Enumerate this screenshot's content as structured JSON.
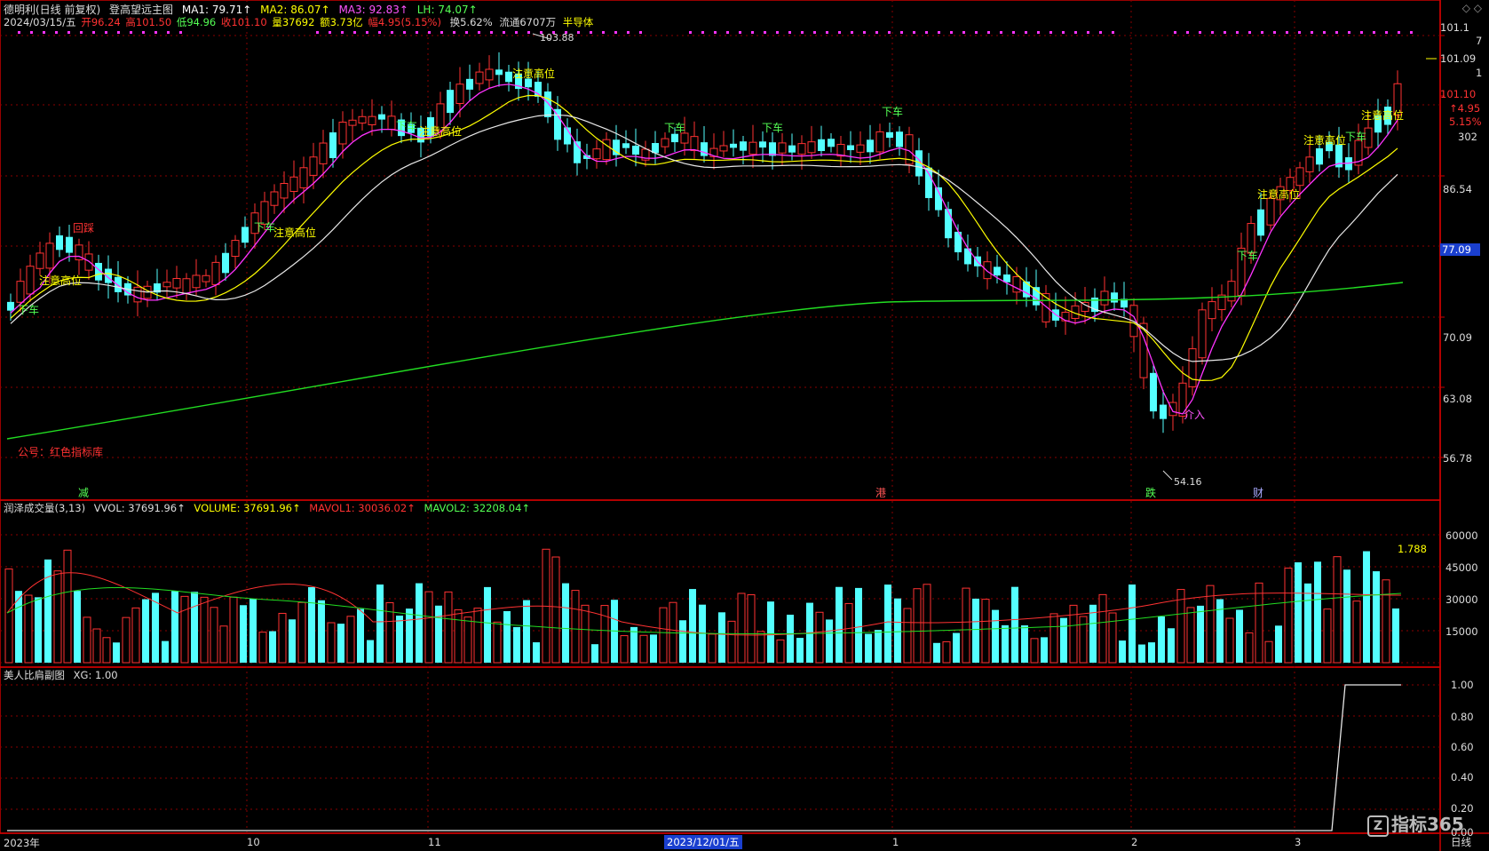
{
  "header": {
    "stock_name": "德明利(日线 前复权)",
    "indicator_name": "登高望远主图",
    "ma1": "MA1: 79.71↑",
    "ma2": "MA2: 86.07↑",
    "ma3": "MA3: 92.83↑",
    "lh": "LH: 74.07↑",
    "date": "2024/03/15/五",
    "open": "开96.24",
    "high": "高101.50",
    "low": "低94.96",
    "close": "收101.10",
    "vol": "量37692",
    "amount": "额3.73亿",
    "change": "幅4.95(5.15%)",
    "turnover": "换5.62%",
    "float_cap": "流通6707万",
    "sector": "半导体",
    "corner_icons": "◇ ◇"
  },
  "main_axis": {
    "labels": [
      "101.10",
      "86.54",
      "70.09",
      "63.08",
      "56.78"
    ],
    "last_price": "101.09",
    "right_side_info": [
      "101.1",
      "7",
      "1",
      "101.10",
      "↑4.95",
      "5.15%",
      "302"
    ],
    "current_marker": "77.09",
    "colors": {
      "current_marker_bg": "#1a3fcf",
      "up": "#ff3232",
      "down": "#54ffff"
    }
  },
  "main_chart": {
    "high_mark": "103.88",
    "low_mark": "54.16",
    "watermark": "公号：红色指标库",
    "bottom_events": [
      {
        "text": "减",
        "color": "#54ff54"
      },
      {
        "text": "港",
        "color": "#ff5555"
      },
      {
        "text": "跌",
        "color": "#54ff54"
      },
      {
        "text": "财",
        "color": "#aaaaff"
      }
    ],
    "signals": [
      {
        "text": "注意高位",
        "color": "#ffff00"
      },
      {
        "text": "下车",
        "color": "#54ff54"
      },
      {
        "text": "介入",
        "color": "#ff55ff"
      },
      {
        "text": "回踩",
        "color": "#ff3232"
      }
    ]
  },
  "volume_panel": {
    "title": "润泽成交量(3,13)",
    "vvol": "VVOL: 37691.96↑",
    "volume": "VOLUME: 37691.96↑",
    "mavol1": "MAVOL1: 30036.02↑",
    "mavol2": "MAVOL2: 32208.04↑",
    "ratio": "1.788",
    "axis": [
      "60000",
      "45000",
      "30000",
      "15000"
    ]
  },
  "xg_panel": {
    "title": "美人比肩副图",
    "xg": "XG: 1.00",
    "axis": [
      "1.00",
      "0.80",
      "0.60",
      "0.40",
      "0.20",
      "0.00"
    ]
  },
  "time_axis": {
    "labels": [
      "2023年",
      "10",
      "11",
      "1",
      "2",
      "3"
    ],
    "cursor_date": "2023/12/01/五",
    "period": "日线",
    "logo": "指标365"
  }
}
